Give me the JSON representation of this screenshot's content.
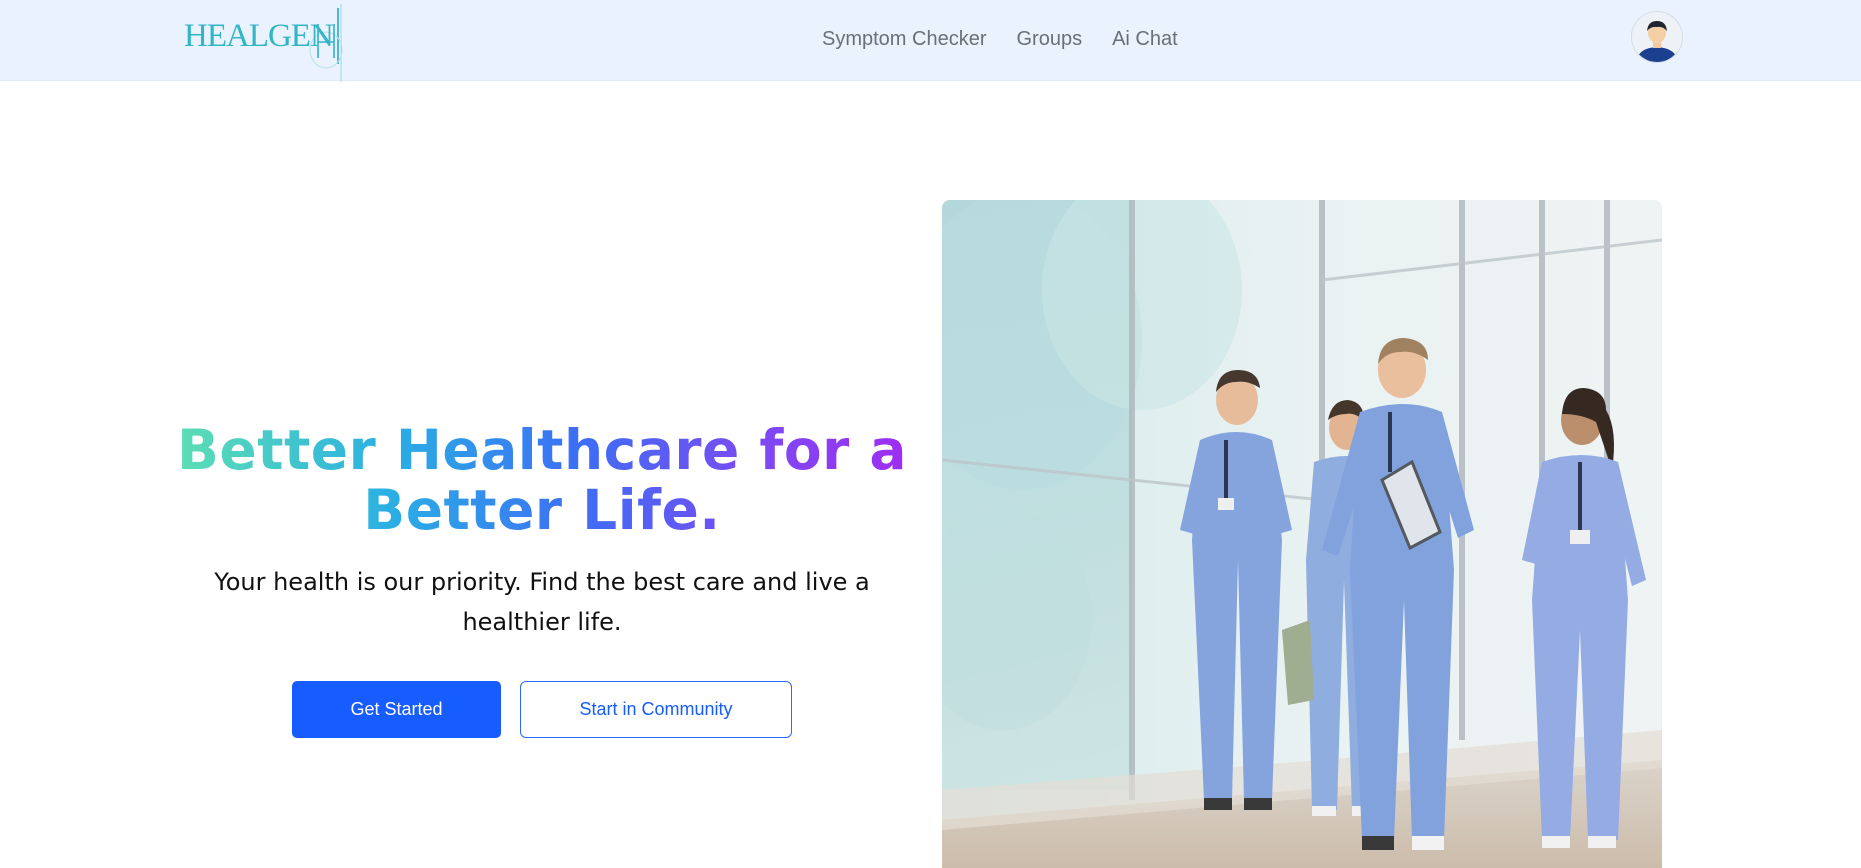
{
  "brand": {
    "logo_text": "HEALGEN"
  },
  "nav": {
    "links": [
      {
        "label": "Symptom Checker"
      },
      {
        "label": "Groups"
      },
      {
        "label": "Ai Chat"
      }
    ]
  },
  "hero": {
    "title_line1": "Better Healthcare for a",
    "title_line2": "Better Life.",
    "subtitle": "Your health is our priority. Find the best care and live a healthier life.",
    "primary_button": "Get Started",
    "secondary_button": "Start in Community"
  },
  "colors": {
    "nav_bg": "#eaf2fd",
    "primary": "#175cff",
    "gradient": [
      "#5ee0b2",
      "#2aaee4",
      "#3d6ef5",
      "#7a4bf3",
      "#a12cf2"
    ],
    "scrubs": "#7e9fdc"
  },
  "icons": {
    "avatar": "user-avatar-icon"
  }
}
